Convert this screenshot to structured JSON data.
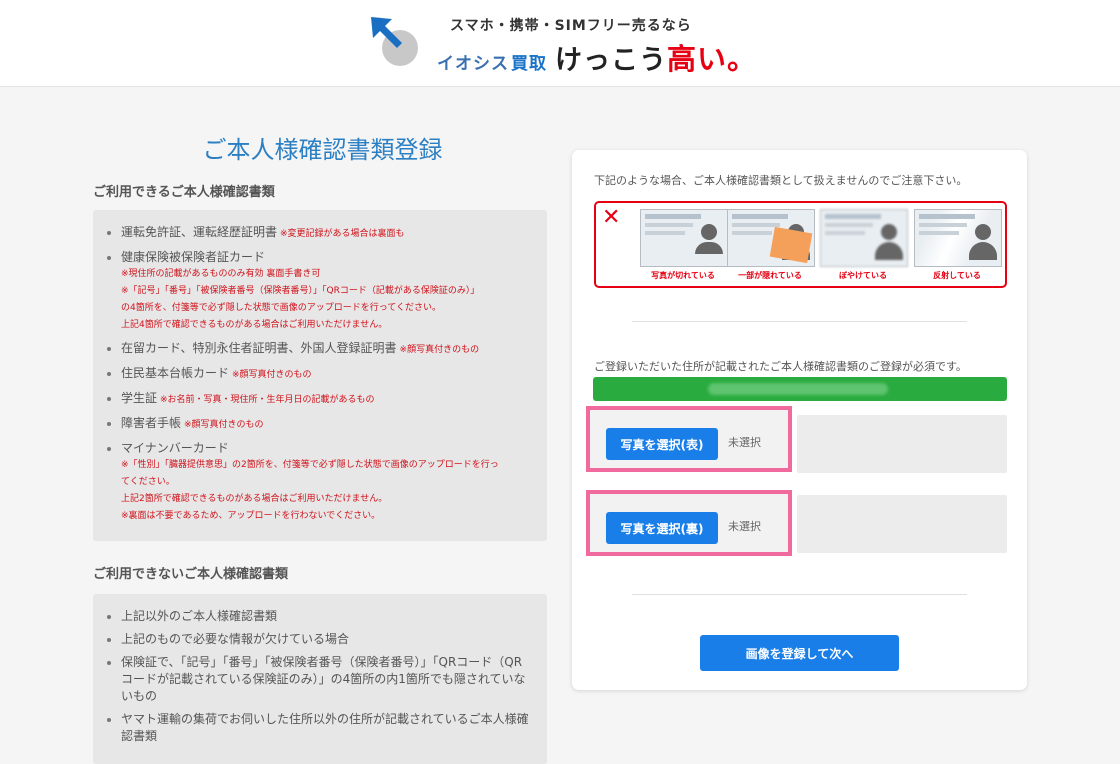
{
  "header": {
    "tagline": "スマホ・携帯・SIMフリー売るなら",
    "brand_part1": "イオシス",
    "brand_part2": "買取",
    "brand_part3": "けっこう",
    "brand_part4": "高い。",
    "logo_icon": "magnifier-arrow-icon"
  },
  "page": {
    "title": "ご本人様確認書類登録"
  },
  "accepted": {
    "heading": "ご利用できるご本人様確認書類",
    "items": [
      {
        "label": "運転免許証、運転経歴証明書",
        "note": "※変更記録がある場合は裏面も",
        "notes": []
      },
      {
        "label": "健康保険被保険者証カード",
        "note": "",
        "notes": [
          "※現住所の記載があるもののみ有効 裏面手書き可",
          "※「記号」「番号」「被保険者番号（保険者番号）」「QRコード（記載がある保険証のみ）」",
          "の4箇所を、付箋等で必ず隠した状態で画像のアップロードを行ってください。",
          "上記4箇所で確認できるものがある場合はご利用いただけません。"
        ]
      },
      {
        "label": "在留カード、特別永住者証明書、外国人登録証明書",
        "note": "※顔写真付きのもの",
        "notes": []
      },
      {
        "label": "住民基本台帳カード",
        "note": "※顔写真付きのもの",
        "notes": []
      },
      {
        "label": "学生証",
        "note": "※お名前・写真・現住所・生年月日の記載があるもの",
        "notes": []
      },
      {
        "label": "障害者手帳",
        "note": "※顔写真付きのもの",
        "notes": []
      },
      {
        "label": "マイナンバーカード",
        "note": "",
        "notes": [
          "※「性別」「臓器提供意思」の2箇所を、付箋等で必ず隠した状態で画像のアップロードを行っ",
          "てください。",
          "上記2箇所で確認できるものがある場合はご利用いただけません。",
          "※裏面は不要であるため、アップロードを行わないでください。"
        ]
      }
    ]
  },
  "rejected": {
    "heading": "ご利用できないご本人様確認書類",
    "items": [
      "上記以外のご本人様確認書類",
      "上記のもので必要な情報が欠けている場合",
      "保険証で、「記号」「番号」「被保険者番号（保険者番号）」「QRコード（QRコードが記載されている保険証のみ）」の4箇所の内1箇所でも隠されていないもの",
      "ヤマト運輸の集荷でお伺いした住所以外の住所が記載されているご本人様確認書類"
    ]
  },
  "card": {
    "notice": "下記のような場合、ご本人様確認書類として扱えませんのでご注意下さい。",
    "ng_labels": [
      "写真が切れている",
      "一部が隠れている",
      "ぼやけている",
      "反射している"
    ],
    "required_text": "ご登録いただいた住所が記載されたご本人様確認書類のご登録が必須です。",
    "upload_front": {
      "label": "写真を選択(表)",
      "status": "未選択"
    },
    "upload_back": {
      "label": "写真を選択(裏)",
      "status": "未選択"
    },
    "submit_label": "画像を登録して次へ"
  },
  "colors": {
    "accent_blue": "#1a7ee8",
    "title_blue": "#2b7fc3",
    "warning_red": "#e60012",
    "highlight_pink": "#f06a9e",
    "status_green": "#2aab3f"
  }
}
